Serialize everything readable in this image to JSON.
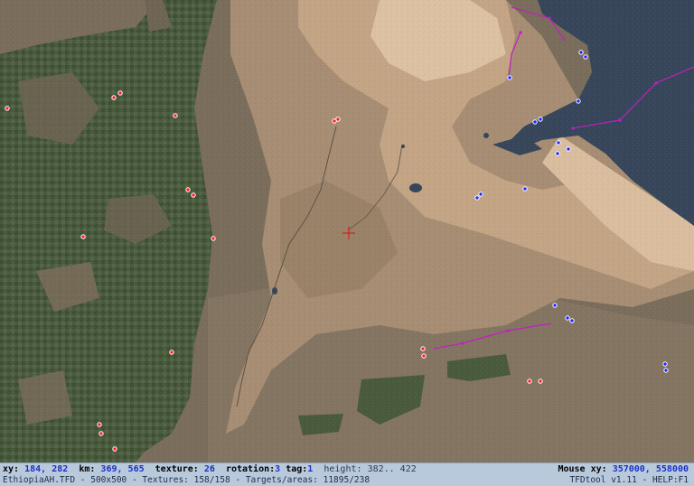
{
  "app": {
    "name": "TFDtool v1.11",
    "help": "HELP:F1"
  },
  "status": {
    "xy_label": "xy:",
    "xy_x": "184,",
    "xy_y": "282",
    "km_label": "km:",
    "km_x": "369,",
    "km_y": "565",
    "texture_label": "texture:",
    "texture_value": "26",
    "rotation_label": "rotation:",
    "rotation_value": "3",
    "tag_label": "tag:",
    "tag_value": "1",
    "height_label": "height:",
    "height_value": "382.. 422",
    "mouse_label": "Mouse xy:",
    "mouse_x": "357000,",
    "mouse_y": "558000",
    "file_line": "EthiopiaAH.TFD - 500x500 - Textures: 158/158 - Targets/areas: 11895/238",
    "version_line": "TFDtool v1.11 - HELP:F1"
  },
  "colors": {
    "forest": "#4a5a3c",
    "forest_dark": "#3d4b33",
    "lowland": "#7a6c5a",
    "highland": "#a08870",
    "plateau": "#c4a688",
    "light_plateau": "#dcc2a4",
    "sea": "#37465a",
    "red_target": "#ff2020",
    "blue_target": "#1e28ff",
    "route": "#c020c0",
    "cursor": "#e01010"
  },
  "map_markers": {
    "cursor": "map-cursor-crosshair",
    "red_targets": "red-target-marker",
    "blue_targets": "blue-target-marker",
    "routes": "magenta-route-line"
  }
}
